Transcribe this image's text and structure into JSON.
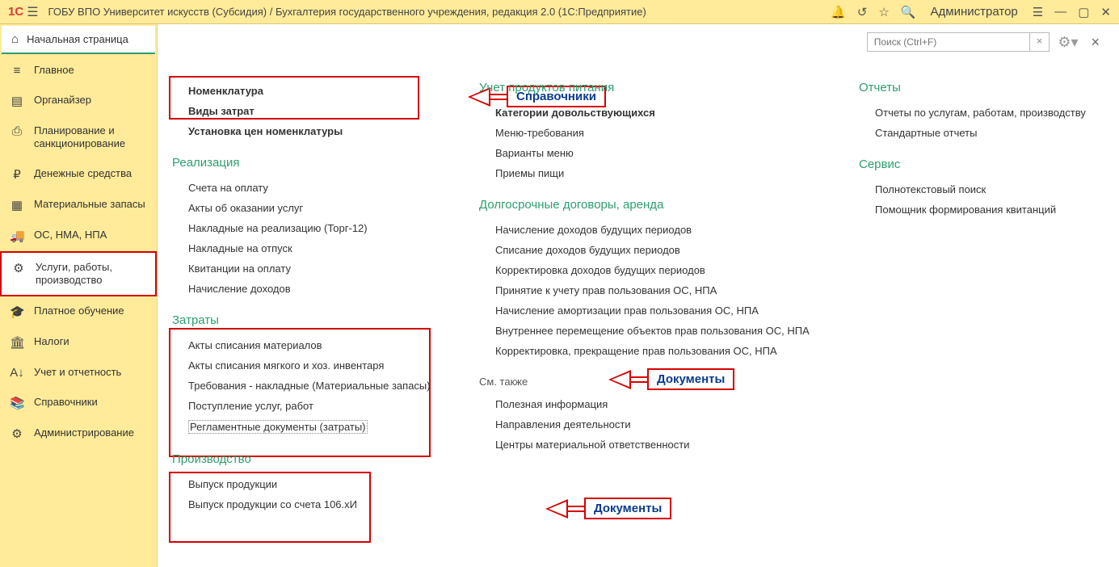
{
  "titlebar": {
    "logo": "1C",
    "title": "ГОБУ ВПО Университет искусств (Субсидия) / Бухгалтерия государственного учреждения, редакция 2.0  (1С:Предприятие)",
    "user": "Администратор"
  },
  "home": {
    "label": "Начальная страница"
  },
  "sidebar": {
    "items": [
      {
        "icon": "≡",
        "label": "Главное"
      },
      {
        "icon": "▤",
        "label": "Органайзер"
      },
      {
        "icon": "⎙",
        "label": "Планирование и санкционирование"
      },
      {
        "icon": "₽",
        "label": "Денежные средства"
      },
      {
        "icon": "▦",
        "label": "Материальные запасы"
      },
      {
        "icon": "🚚",
        "label": "ОС, НМА, НПА"
      },
      {
        "icon": "⚙",
        "label": "Услуги, работы, производство"
      },
      {
        "icon": "🎓",
        "label": "Платное обучение"
      },
      {
        "icon": "🏛",
        "label": "Налоги"
      },
      {
        "icon": "A↓",
        "label": "Учет и отчетность"
      },
      {
        "icon": "📚",
        "label": "Справочники"
      },
      {
        "icon": "⚙",
        "label": "Администрирование"
      }
    ]
  },
  "search": {
    "placeholder": "Поиск (Ctrl+F)"
  },
  "col1": {
    "g0": {
      "items": [
        {
          "label": "Номенклатура",
          "bold": true
        },
        {
          "label": "Виды затрат",
          "bold": true
        },
        {
          "label": "Установка цен номенклатуры",
          "bold": true
        }
      ]
    },
    "g1": {
      "title": "Реализация",
      "items": [
        {
          "label": "Счета на оплату"
        },
        {
          "label": "Акты об оказании услуг"
        },
        {
          "label": "Накладные на реализацию (Торг-12)"
        },
        {
          "label": "Накладные на отпуск"
        },
        {
          "label": "Квитанции на оплату"
        },
        {
          "label": "Начисление доходов"
        }
      ]
    },
    "g2": {
      "title": "Затраты",
      "items": [
        {
          "label": "Акты списания материалов"
        },
        {
          "label": "Акты списания мягкого и хоз. инвентаря"
        },
        {
          "label": "Требования - накладные (Материальные запасы)"
        },
        {
          "label": "Поступление услуг, работ"
        },
        {
          "label": "Регламентные документы (затраты)",
          "dotted": true
        }
      ]
    },
    "g3": {
      "title": "Производство",
      "items": [
        {
          "label": "Выпуск продукции"
        },
        {
          "label": "Выпуск продукции со счета 106.хИ"
        }
      ]
    }
  },
  "col2": {
    "g0": {
      "title": "Учет продуктов питания",
      "items": [
        {
          "label": "Категории довольствующихся",
          "bold": true
        },
        {
          "label": "Меню-требования"
        },
        {
          "label": "Варианты меню"
        },
        {
          "label": "Приемы пищи"
        }
      ]
    },
    "g1": {
      "title": "Долгосрочные договоры, аренда",
      "items": [
        {
          "label": "Начисление доходов будущих периодов"
        },
        {
          "label": "Списание доходов будущих периодов"
        },
        {
          "label": "Корректировка доходов будущих периодов"
        },
        {
          "label": "Принятие к учету прав пользования ОС, НПА"
        },
        {
          "label": "Начисление амортизации прав пользования ОС, НПА"
        },
        {
          "label": "Внутреннее перемещение объектов прав пользования ОС, НПА"
        },
        {
          "label": "Корректировка, прекращение прав пользования ОС, НПА"
        }
      ]
    },
    "see_also": "См. также",
    "g2": {
      "items": [
        {
          "label": "Полезная информация"
        },
        {
          "label": "Направления деятельности"
        },
        {
          "label": "Центры материальной ответственности"
        }
      ]
    }
  },
  "col3": {
    "g0": {
      "title": "Отчеты",
      "items": [
        {
          "label": "Отчеты по услугам, работам, производству"
        },
        {
          "label": "Стандартные отчеты"
        }
      ]
    },
    "g1": {
      "title": "Сервис",
      "items": [
        {
          "label": "Полнотекстовый поиск"
        },
        {
          "label": "Помощник формирования квитанций"
        }
      ]
    }
  },
  "callouts": {
    "c1": "Справочники",
    "c2": "Документы",
    "c3": "Документы"
  }
}
